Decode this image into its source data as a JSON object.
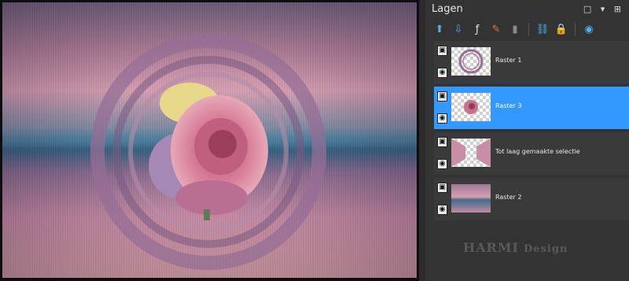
{
  "panel": {
    "title": "Lagen",
    "window_controls": "□ ▾ ⊞"
  },
  "toolbar": {
    "icons": [
      "new-raster-layer-icon",
      "new-vector-layer-icon",
      "adjustment-layer-icon",
      "paint-brush-icon",
      "delete-layer-icon",
      "link-icon",
      "lock-icon",
      "visibility-icon"
    ]
  },
  "layers": [
    {
      "name": "Raster 1",
      "selected": false,
      "thumb": "rings"
    },
    {
      "name": "Raster 3",
      "selected": true,
      "thumb": "rose"
    },
    {
      "name": "Tot laag gemaakte selectie",
      "selected": false,
      "thumb": "selection"
    },
    {
      "name": "Raster 2",
      "selected": false,
      "thumb": "background"
    }
  ],
  "watermark": {
    "brand": "HARMI",
    "suffix": "Design"
  },
  "colors": {
    "selection": "#3399ff",
    "panel_bg": "#333333",
    "accent_icon": "#4fb3ea"
  }
}
